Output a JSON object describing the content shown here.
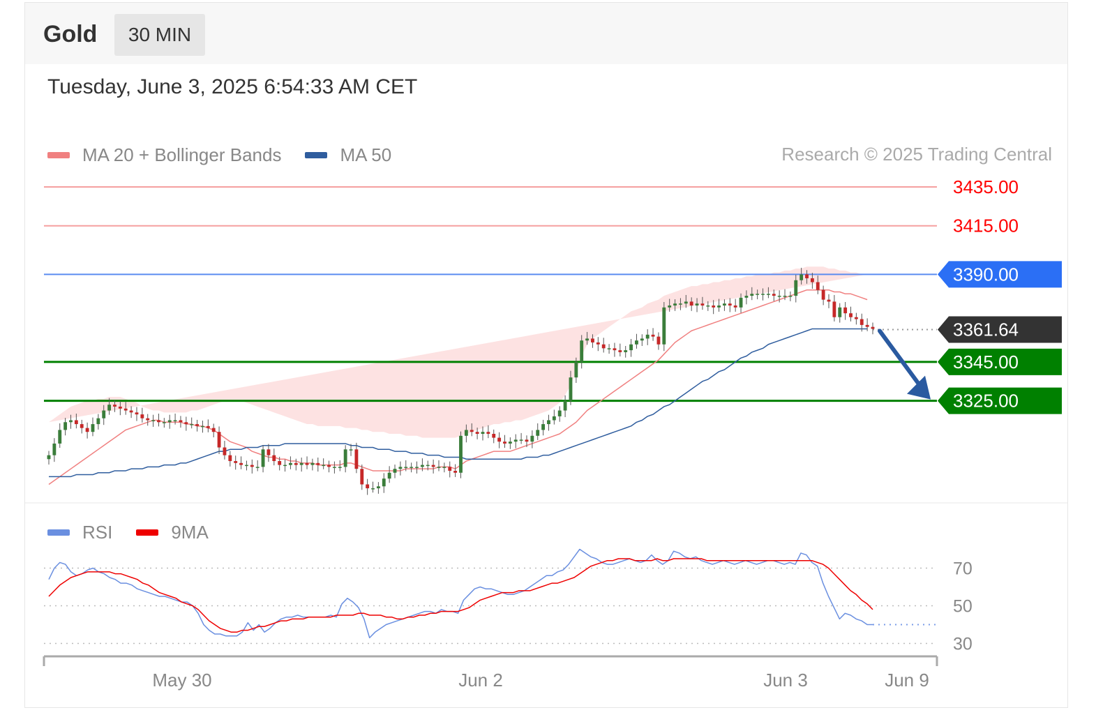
{
  "header": {
    "instrument": "Gold",
    "timeframe": "30 MIN",
    "datetime": "Tuesday, June 3, 2025 6:54:33 AM CET"
  },
  "legend": {
    "ma20": {
      "label": "MA 20 + Bollinger Bands",
      "color": "#f08080"
    },
    "ma50": {
      "label": "MA 50",
      "color": "#2f5d9e"
    }
  },
  "credit": "Research © 2025 Trading Central",
  "rsi_legend": {
    "rsi": {
      "label": "RSI",
      "color": "#6a8fe0"
    },
    "ma9": {
      "label": "9MA",
      "color": "#ee0000"
    }
  },
  "colors": {
    "bull_candle": "#3a7d3a",
    "bear_candle": "#c62828",
    "band_fill": "#fde2e2",
    "resistance": "#ff0000",
    "pivot": "#2b6ff5",
    "support": "#008000",
    "current": "#333333",
    "arrow": "#2a5aa0"
  },
  "chart_data": [
    {
      "type": "candlestick",
      "title": "Gold",
      "timeframe": "30 MIN",
      "x_ticks": [
        "May 30",
        "Jun 2",
        "Jun 3",
        "Jun 9"
      ],
      "ylim": [
        3275,
        3440
      ],
      "levels": [
        {
          "label": "3435.00",
          "value": 3435.0,
          "kind": "resistance"
        },
        {
          "label": "3415.00",
          "value": 3415.0,
          "kind": "resistance"
        },
        {
          "label": "3390.00",
          "value": 3390.0,
          "kind": "pivot"
        },
        {
          "label": "3361.64",
          "value": 3361.64,
          "kind": "current"
        },
        {
          "label": "3345.00",
          "value": 3345.0,
          "kind": "support"
        },
        {
          "label": "3325.00",
          "value": 3325.0,
          "kind": "support"
        }
      ],
      "close": [
        3297,
        3303,
        3310,
        3314,
        3315,
        3313,
        3311,
        3309,
        3313,
        3316,
        3320,
        3323,
        3322,
        3321,
        3320,
        3319,
        3318,
        3316,
        3315,
        3315,
        3314,
        3314,
        3315,
        3315,
        3314,
        3313,
        3313,
        3312,
        3312,
        3311,
        3309,
        3301,
        3297,
        3294,
        3293,
        3292,
        3292,
        3291,
        3291,
        3300,
        3297,
        3294,
        3292,
        3292,
        3293,
        3292,
        3293,
        3292,
        3293,
        3292,
        3292,
        3291,
        3291,
        3291,
        3300,
        3300,
        3290,
        3282,
        3280,
        3280,
        3281,
        3285,
        3288,
        3290,
        3291,
        3291,
        3291,
        3291,
        3292,
        3292,
        3291,
        3291,
        3291,
        3289,
        3288,
        3307,
        3310,
        3309,
        3308,
        3309,
        3308,
        3306,
        3304,
        3303,
        3304,
        3305,
        3305,
        3304,
        3307,
        3310,
        3313,
        3315,
        3317,
        3320,
        3325,
        3337,
        3345,
        3356,
        3357,
        3355,
        3354,
        3352,
        3352,
        3351,
        3350,
        3351,
        3354,
        3356,
        3357,
        3359,
        3358,
        3354,
        3373,
        3374,
        3375,
        3375,
        3376,
        3374,
        3375,
        3374,
        3374,
        3373,
        3374,
        3375,
        3374,
        3373,
        3378,
        3379,
        3380,
        3380,
        3380,
        3380,
        3379,
        3379,
        3379,
        3379,
        3387,
        3390,
        3388,
        3386,
        3382,
        3377,
        3376,
        3368,
        3373,
        3370,
        3368,
        3367,
        3364,
        3363,
        3362
      ],
      "ma20": [
        3282,
        3284,
        3286,
        3288,
        3290,
        3292,
        3294,
        3296,
        3298,
        3300,
        3302,
        3304,
        3306,
        3308,
        3310,
        3311,
        3312,
        3313,
        3314,
        3315,
        3315,
        3314,
        3314,
        3314,
        3314,
        3313,
        3313,
        3312,
        3312,
        3311,
        3310,
        3308,
        3306,
        3304,
        3303,
        3302,
        3301,
        3299,
        3298,
        3297,
        3296,
        3296,
        3295,
        3295,
        3294,
        3294,
        3293,
        3293,
        3293,
        3292,
        3292,
        3292,
        3292,
        3292,
        3293,
        3293,
        3292,
        3291,
        3290,
        3289,
        3289,
        3289,
        3289,
        3289,
        3289,
        3290,
        3290,
        3290,
        3290,
        3290,
        3290,
        3291,
        3291,
        3291,
        3290,
        3292,
        3294,
        3295,
        3296,
        3297,
        3298,
        3299,
        3299,
        3299,
        3299,
        3300,
        3301,
        3302,
        3303,
        3304,
        3305,
        3306,
        3307,
        3308,
        3310,
        3312,
        3314,
        3317,
        3320,
        3322,
        3324,
        3326,
        3328,
        3330,
        3332,
        3334,
        3336,
        3338,
        3340,
        3342,
        3344,
        3346,
        3349,
        3352,
        3355,
        3357,
        3359,
        3361,
        3362,
        3363,
        3364,
        3365,
        3366,
        3367,
        3368,
        3369,
        3370,
        3371,
        3372,
        3373,
        3374,
        3375,
        3376,
        3377,
        3378,
        3379,
        3380,
        3381,
        3382,
        3382,
        3382,
        3382,
        3382,
        3381,
        3381,
        3380,
        3380,
        3379,
        3378,
        3377
      ],
      "ma50": [
        3286,
        3286,
        3286,
        3286,
        3286,
        3287,
        3287,
        3287,
        3287,
        3288,
        3288,
        3288,
        3289,
        3289,
        3289,
        3290,
        3290,
        3290,
        3291,
        3291,
        3291,
        3292,
        3292,
        3292,
        3293,
        3293,
        3294,
        3295,
        3296,
        3297,
        3298,
        3299,
        3299,
        3300,
        3300,
        3300,
        3301,
        3301,
        3301,
        3302,
        3302,
        3302,
        3302,
        3303,
        3303,
        3303,
        3303,
        3303,
        3303,
        3303,
        3303,
        3303,
        3303,
        3303,
        3303,
        3302,
        3302,
        3301,
        3301,
        3301,
        3300,
        3300,
        3300,
        3299,
        3299,
        3299,
        3298,
        3298,
        3298,
        3297,
        3297,
        3297,
        3296,
        3296,
        3296,
        3296,
        3295,
        3295,
        3295,
        3295,
        3295,
        3295,
        3295,
        3295,
        3295,
        3295,
        3295,
        3296,
        3296,
        3296,
        3297,
        3297,
        3298,
        3299,
        3300,
        3301,
        3302,
        3303,
        3304,
        3305,
        3306,
        3307,
        3308,
        3309,
        3310,
        3311,
        3312,
        3314,
        3315,
        3317,
        3318,
        3320,
        3322,
        3323,
        3325,
        3327,
        3329,
        3331,
        3333,
        3335,
        3336,
        3338,
        3340,
        3341,
        3343,
        3345,
        3347,
        3348,
        3350,
        3351,
        3352,
        3354,
        3355,
        3356,
        3357,
        3358,
        3359,
        3360,
        3361,
        3362,
        3362,
        3362,
        3362,
        3362,
        3362,
        3362,
        3362,
        3362,
        3362,
        3362
      ],
      "band_upper": [
        3314,
        3316,
        3318,
        3320,
        3322,
        3323,
        3324,
        3325,
        3325,
        3326,
        3326,
        3327,
        3327,
        3327,
        3326,
        3325,
        3324,
        3322,
        3321,
        3320,
        3320,
        3319,
        3319,
        3319,
        3319,
        3319,
        3320,
        3320,
        3321,
        3322,
        3323,
        3324,
        3325,
        3325,
        3325,
        3325,
        3324,
        3323,
        3322,
        3321,
        3320,
        3319,
        3318,
        3317,
        3316,
        3315,
        3314,
        3313,
        3313,
        3312,
        3312,
        3312,
        3312,
        3312,
        3311,
        3311,
        3311,
        3310,
        3310,
        3309,
        3309,
        3309,
        3308,
        3308,
        3308,
        3307,
        3307,
        3307,
        3306,
        3306,
        3306,
        3306,
        3306,
        3306,
        3306,
        3307,
        3308,
        3309,
        3310,
        3311,
        3312,
        3313,
        3313,
        3314,
        3314,
        3315,
        3315,
        3316,
        3317,
        3318,
        3319,
        3320,
        3322,
        3324,
        3328,
        3333,
        3340,
        3348,
        3354,
        3357,
        3359,
        3361,
        3363,
        3365,
        3367,
        3369,
        3371,
        3372,
        3373,
        3375,
        3376,
        3377,
        3379,
        3380,
        3381,
        3382,
        3383,
        3384,
        3384,
        3385,
        3385,
        3386,
        3386,
        3387,
        3387,
        3388,
        3388,
        3389,
        3389,
        3390,
        3390,
        3390,
        3391,
        3391,
        3392,
        3392,
        3393,
        3393,
        3394,
        3394,
        3394,
        3394,
        3393,
        3393,
        3392,
        3392,
        3391,
        3391,
        3390,
        3390
      ],
      "band_lower": [
        3252,
        3253,
        3254,
        3256,
        3258,
        3261,
        3264,
        3267,
        3270,
        3274,
        3278,
        3281,
        3285,
        3289,
        3292,
        3295,
        3297,
        3299,
        3300,
        3301,
        3302,
        3302,
        3303,
        3303,
        3302,
        3301,
        3300,
        3299,
        3298,
        3297,
        3295,
        3293,
        3291,
        3289,
        3288,
        3287,
        3286,
        3285,
        3285,
        3284,
        3284,
        3283,
        3283,
        3283,
        3282,
        3282,
        3282,
        3282,
        3282,
        3282,
        3282,
        3281,
        3281,
        3280,
        3279,
        3278,
        3276,
        3274,
        3272,
        3272,
        3272,
        3272,
        3272,
        3273,
        3273,
        3273,
        3273,
        3273,
        3273,
        3274,
        3274,
        3274,
        3274,
        3274,
        3274,
        3274,
        3274,
        3275,
        3275,
        3276,
        3276,
        3277,
        3277,
        3278,
        3278,
        3278,
        3279,
        3279,
        3280,
        3281,
        3282,
        3283,
        3284,
        3285,
        3286,
        3286,
        3286,
        3286,
        3287,
        3288,
        3289,
        3290,
        3292,
        3294,
        3296,
        3298,
        3300,
        3303,
        3306,
        3310,
        3313,
        3316,
        3319,
        3322,
        3325,
        3328,
        3331,
        3333,
        3335,
        3337,
        3339,
        3341,
        3343,
        3345,
        3346,
        3347,
        3348,
        3349,
        3350,
        3351,
        3352,
        3353,
        3354,
        3355,
        3356,
        3357,
        3358,
        3359,
        3360,
        3361,
        3362,
        3362,
        3362,
        3362,
        3362,
        3362,
        3362,
        3362,
        3362,
        3362
      ],
      "forecast_arrow": {
        "from_value": 3361.64,
        "to_value": 3325.0
      }
    },
    {
      "type": "line",
      "title": "RSI",
      "ylim": [
        25,
        85
      ],
      "y_ticks": [
        70,
        50,
        30
      ],
      "series": [
        {
          "name": "RSI",
          "values": [
            64,
            70,
            73,
            72,
            68,
            66,
            67,
            69,
            70,
            68,
            67,
            65,
            64,
            62,
            62,
            61,
            59,
            58,
            57,
            56,
            55,
            55,
            54,
            53,
            52,
            52,
            50,
            46,
            40,
            37,
            35,
            35,
            34,
            34,
            34,
            36,
            41,
            37,
            40,
            36,
            38,
            41,
            43,
            44,
            44,
            45,
            44,
            44,
            44,
            44,
            44,
            45,
            44,
            51,
            54,
            52,
            49,
            43,
            33,
            36,
            38,
            40,
            41,
            42,
            43,
            44,
            45,
            46,
            47,
            47,
            46,
            48,
            47,
            47,
            46,
            53,
            56,
            59,
            60,
            59,
            59,
            58,
            57,
            56,
            56,
            57,
            58,
            60,
            62,
            64,
            66,
            66,
            68,
            69,
            72,
            76,
            80,
            78,
            76,
            75,
            73,
            72,
            72,
            73,
            74,
            75,
            74,
            73,
            74,
            77,
            74,
            72,
            74,
            79,
            78,
            76,
            75,
            76,
            74,
            73,
            72,
            73,
            74,
            73,
            72,
            73,
            74,
            73,
            72,
            73,
            74,
            74,
            73,
            72,
            73,
            72,
            78,
            77,
            73,
            71,
            62,
            55,
            49,
            43,
            46,
            45,
            43,
            42,
            40,
            40
          ]
        },
        {
          "name": "9MA",
          "values": [
            55,
            58,
            61,
            63,
            65,
            66,
            67,
            68,
            68,
            68,
            68,
            68,
            67,
            67,
            66,
            65,
            64,
            62,
            61,
            59,
            57,
            56,
            55,
            54,
            52,
            51,
            50,
            48,
            45,
            42,
            40,
            38,
            37,
            36,
            36,
            37,
            37,
            38,
            39,
            39,
            40,
            41,
            42,
            42,
            43,
            43,
            43,
            44,
            44,
            44,
            44,
            44,
            45,
            45,
            45,
            45,
            46,
            46,
            45,
            45,
            45,
            44,
            44,
            43,
            43,
            44,
            44,
            45,
            45,
            46,
            46,
            47,
            47,
            47,
            47,
            48,
            49,
            51,
            53,
            54,
            55,
            56,
            57,
            57,
            57,
            58,
            58,
            58,
            59,
            60,
            61,
            62,
            62,
            63,
            64,
            65,
            67,
            69,
            71,
            72,
            73,
            74,
            74,
            75,
            75,
            75,
            74,
            74,
            74,
            74,
            75,
            74,
            74,
            75,
            75,
            75,
            75,
            75,
            75,
            74,
            74,
            74,
            74,
            74,
            74,
            74,
            74,
            74,
            74,
            74,
            74,
            74,
            74,
            74,
            74,
            74,
            74,
            74,
            74,
            73,
            72,
            70,
            67,
            64,
            61,
            58,
            56,
            53,
            51,
            48
          ]
        }
      ]
    }
  ]
}
